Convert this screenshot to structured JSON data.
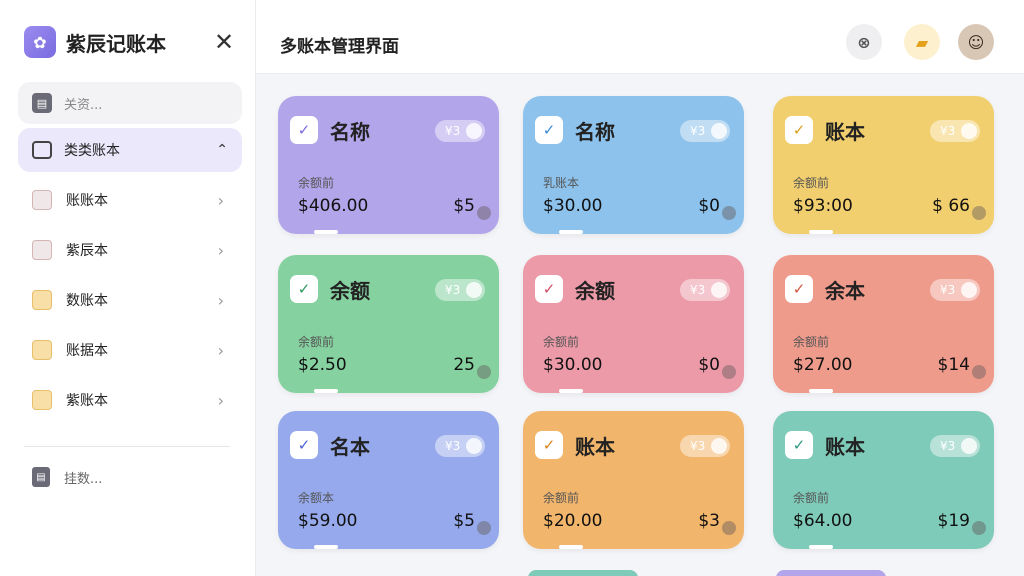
{
  "sidebar": {
    "brand": "紫辰记账本",
    "close": "✕",
    "search_placeholder": "关资...",
    "active": {
      "label": "类类账本",
      "chevron": "^"
    },
    "items": [
      {
        "label": "账账本"
      },
      {
        "label": "紫辰本"
      },
      {
        "label": "数账本"
      },
      {
        "label": "账据本"
      },
      {
        "label": "紫账本"
      }
    ],
    "footer": "挂数..."
  },
  "header": {
    "title": "多账本管理界面"
  },
  "cards": [
    {
      "name": "名称",
      "toggle": "¥3",
      "sub": "余额前",
      "amount": "$406.00",
      "right": "$5",
      "color": "#b3a5ea",
      "accent": "#7a6be0"
    },
    {
      "name": "名称",
      "toggle": "¥3",
      "sub": "乳账本",
      "amount": "$30.00",
      "right": "$0",
      "color": "#8cc2ec",
      "accent": "#3a8bd4"
    },
    {
      "name": "账本",
      "toggle": "¥3",
      "sub": "余额前",
      "amount": "$93:00",
      "right": "$ 66",
      "color": "#f2cf6e",
      "accent": "#d9a11a"
    },
    {
      "name": "余额",
      "toggle": "¥3",
      "sub": "余额前",
      "amount": "$2.50",
      "right": "25",
      "color": "#86d1a0",
      "accent": "#2f9a5a"
    },
    {
      "name": "余额",
      "toggle": "¥3",
      "sub": "余额前",
      "amount": "$30.00",
      "right": "$0",
      "color": "#ec9aa8",
      "accent": "#d44a64"
    },
    {
      "name": "余本",
      "toggle": "¥3",
      "sub": "余额前",
      "amount": "$27.00",
      "right": "$14",
      "color": "#ef9b8c",
      "accent": "#d4543e"
    },
    {
      "name": "名本",
      "toggle": "¥3",
      "sub": "余额本",
      "amount": "$59.00",
      "right": "$5",
      "color": "#95a9ec",
      "accent": "#4a63d4"
    },
    {
      "name": "账本",
      "toggle": "¥3",
      "sub": "余额前",
      "amount": "$20.00",
      "right": "$3",
      "color": "#f2b56c",
      "accent": "#d9831a"
    },
    {
      "name": "账本",
      "toggle": "¥3",
      "sub": "余额前",
      "amount": "$64.00",
      "right": "$19",
      "color": "#7fcbb9",
      "accent": "#2a9a80"
    }
  ]
}
